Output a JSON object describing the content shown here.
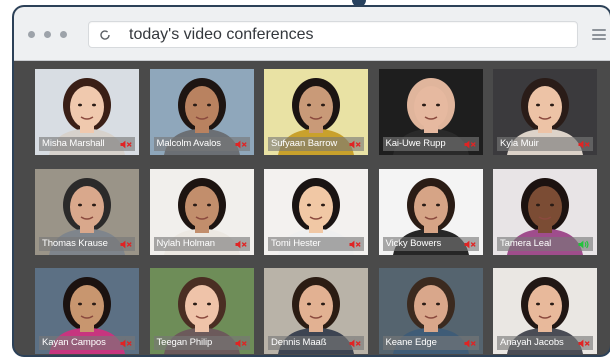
{
  "browser": {
    "address": "today's video conferences"
  },
  "colors": {
    "muted": "#e02424",
    "speaking": "#22c33a",
    "window_frame": "#2c4158",
    "tile_area": "#4a4a4a"
  },
  "participants": [
    {
      "name": "Misha Marshall",
      "audio": "muted",
      "skin": "#f0c9ae",
      "hair": "#3a1f16",
      "bg": "#d8dde3",
      "shirt": "#d7d2cc"
    },
    {
      "name": "Malcolm Avalos",
      "audio": "muted",
      "skin": "#b98260",
      "hair": "#1e1512",
      "bg": "#8fa7bb",
      "shirt": "#6b6f74"
    },
    {
      "name": "Sufyaan Barrow",
      "audio": "muted",
      "skin": "#c99a78",
      "hair": "#1b1412",
      "bg": "#e9e2a4",
      "shirt": "#c9a12c"
    },
    {
      "name": "Kai-Uwe Rupp",
      "audio": "muted",
      "skin": "#e6b9a0",
      "hair": "#e0b59c",
      "bg": "#1e1e1e",
      "shirt": "#2a2a2a"
    },
    {
      "name": "Kyla Muir",
      "audio": "muted",
      "skin": "#edc3a6",
      "hair": "#2a1c18",
      "bg": "#3b3a3d",
      "shirt": "#ddd3c9"
    },
    {
      "name": "Thomas Krause",
      "audio": "muted",
      "skin": "#d9a88c",
      "hair": "#2b2a2a",
      "bg": "#9a9488",
      "shirt": "#7f858c"
    },
    {
      "name": "Nylah Holman",
      "audio": "muted",
      "skin": "#c28e6c",
      "hair": "#1d1411",
      "bg": "#f1efec",
      "shirt": "#ece8e2"
    },
    {
      "name": "Tomi Hester",
      "audio": "muted",
      "skin": "#f1c8a5",
      "hair": "#1a1413",
      "bg": "#f3f1ef",
      "shirt": "#efefef"
    },
    {
      "name": "Vicky Bowers",
      "audio": "muted",
      "skin": "#d6a486",
      "hair": "#2a1c15",
      "bg": "#f4f4f4",
      "shirt": "#262626"
    },
    {
      "name": "Tamera Leal",
      "audio": "speaking",
      "skin": "#7b4c34",
      "hair": "#1c1210",
      "bg": "#e8e4e6",
      "shirt": "#9f4d8c"
    },
    {
      "name": "Kayan Campos",
      "audio": "muted",
      "skin": "#c8966f",
      "hair": "#1b1210",
      "bg": "#5c7084",
      "shirt": "#c7357f"
    },
    {
      "name": "Teegan Philip",
      "audio": "muted",
      "skin": "#efc3a9",
      "hair": "#4a2e23",
      "bg": "#6e8d58",
      "shirt": "#6c5a5b"
    },
    {
      "name": "Dennis Maaß",
      "audio": "muted",
      "skin": "#e2b192",
      "hair": "#2b1c13",
      "bg": "#b9b3a8",
      "shirt": "#3d4452"
    },
    {
      "name": "Keane Edge",
      "audio": "muted",
      "skin": "#d9a78b",
      "hair": "#3b2a1f",
      "bg": "#55646f",
      "shirt": "#3f5c77"
    },
    {
      "name": "Anayah Jacobs",
      "audio": "muted",
      "skin": "#e8b99b",
      "hair": "#211714",
      "bg": "#eae7e3",
      "shirt": "#4a4c55"
    }
  ]
}
